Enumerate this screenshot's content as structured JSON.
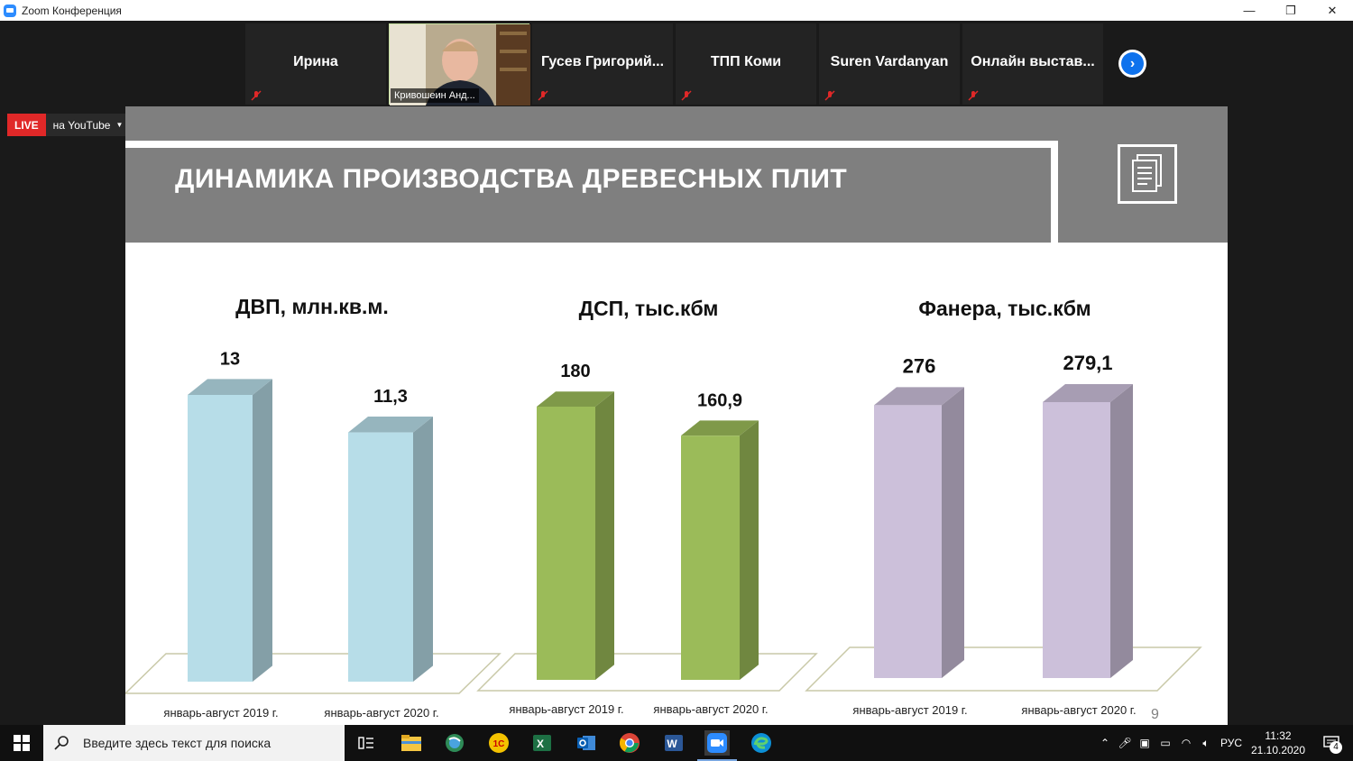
{
  "window": {
    "title": "Zoom Конференция",
    "controls": {
      "minimize": "—",
      "restore": "❐",
      "close": "✕"
    }
  },
  "participants": [
    {
      "name": "Ирина",
      "video": false,
      "muted": true
    },
    {
      "name": "Кривошеин Анд...",
      "video": true,
      "muted": false
    },
    {
      "name": "Гусев Григорий...",
      "video": false,
      "muted": true
    },
    {
      "name": "ТПП Коми",
      "video": false,
      "muted": true
    },
    {
      "name": "Suren Vardanyan",
      "video": false,
      "muted": true
    },
    {
      "name": "Онлайн выстав...",
      "video": false,
      "muted": true
    }
  ],
  "live": {
    "badge": "LIVE",
    "destination": "на YouTube"
  },
  "slide": {
    "title": "ДИНАМИКА ПРОИЗВОДСТВА ДРЕВЕСНЫХ ПЛИТ",
    "page_number": "9",
    "icon": "document-icon"
  },
  "chart_data": [
    {
      "type": "bar",
      "title": "ДВП, млн.кв.м.",
      "categories": [
        "январь-август 2019 г.",
        "январь-август 2020 г."
      ],
      "values": [
        13,
        11.3
      ],
      "value_labels": [
        "13",
        "11,3"
      ],
      "color": "#b7dde8"
    },
    {
      "type": "bar",
      "title": "ДСП, тыс.кбм",
      "categories": [
        "январь-август 2019 г.",
        "январь-август 2020 г."
      ],
      "values": [
        180,
        160.9
      ],
      "value_labels": [
        "180",
        "160,9"
      ],
      "color": "#9bbb59"
    },
    {
      "type": "bar",
      "title": "Фанера, тыс.кбм",
      "categories": [
        "январь-август 2019 г.",
        "январь-август 2020 г."
      ],
      "values": [
        276,
        279.1
      ],
      "value_labels": [
        "276",
        "279,1"
      ],
      "color": "#ccc0da"
    }
  ],
  "taskbar": {
    "search_placeholder": "Введите здесь текст для поиска",
    "apps": [
      "task-view-icon",
      "file-explorer-icon",
      "browser-icon",
      "1c-icon",
      "excel-icon",
      "outlook-icon",
      "chrome-icon",
      "word-icon",
      "zoom-icon",
      "edge-icon"
    ],
    "language": "РУС",
    "time": "11:32",
    "date": "21.10.2020",
    "notifications": "4"
  }
}
